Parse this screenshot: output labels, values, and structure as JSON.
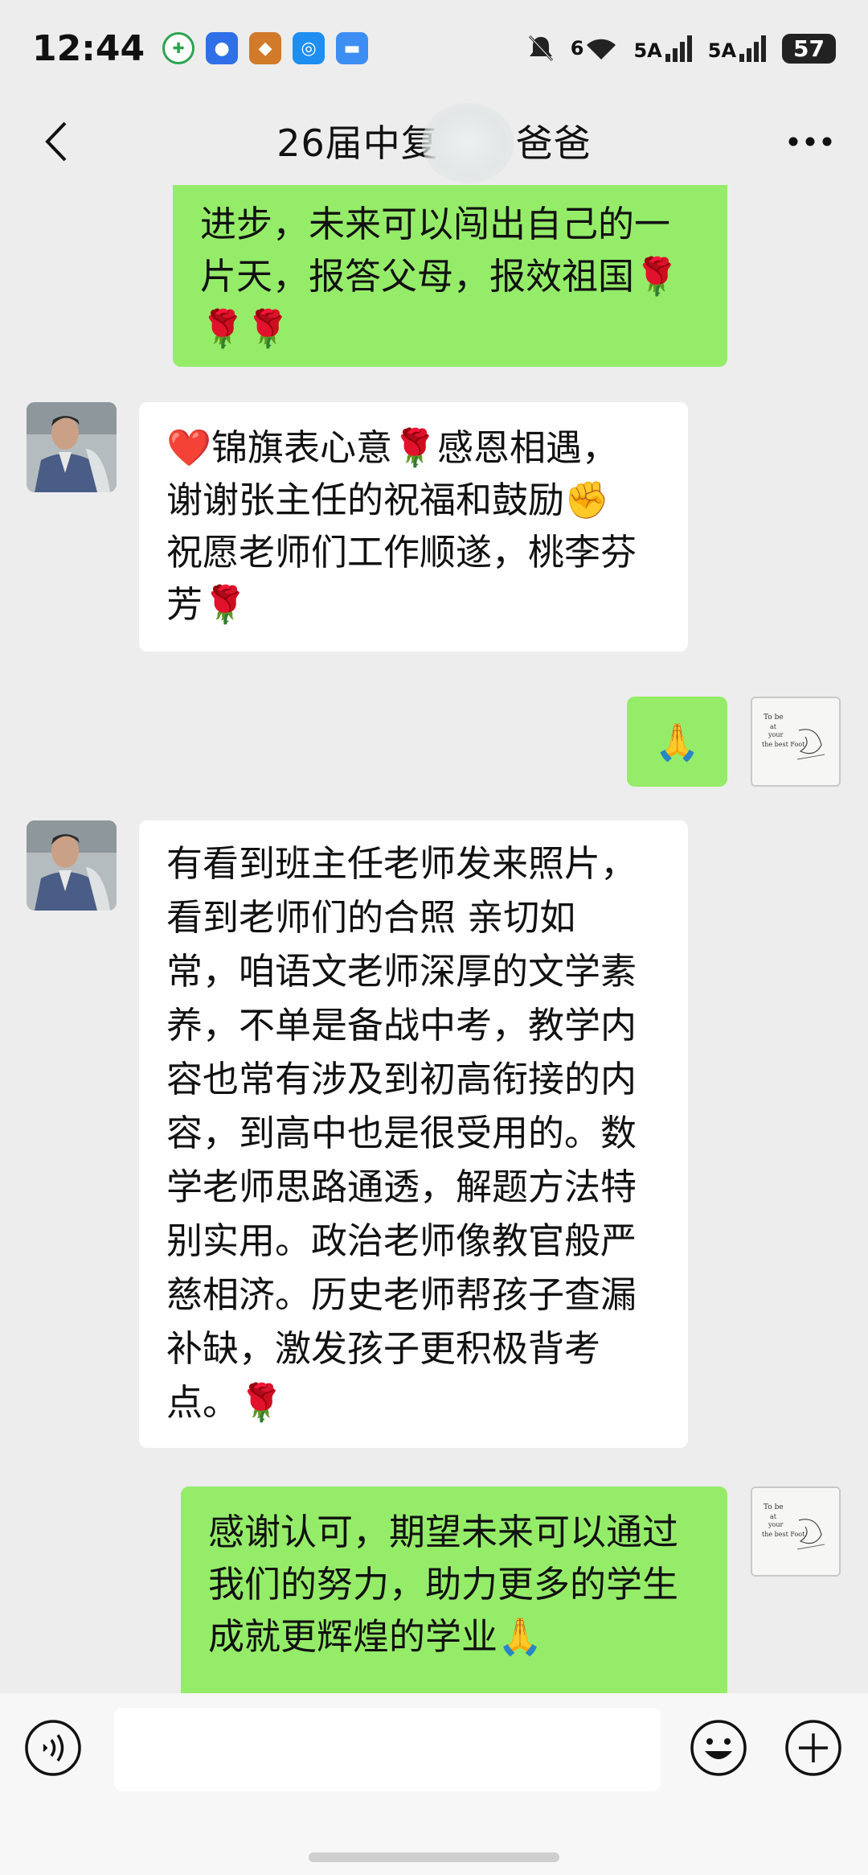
{
  "status_bar": {
    "time": "12:44",
    "signal_1": "6",
    "signal_2": "5A",
    "signal_3": "5A",
    "battery": "57"
  },
  "header": {
    "title": "26届中复",
    "title_suffix": "爸爸"
  },
  "messages": [
    {
      "side": "right",
      "lines": [
        "进步，未来可以闯出自己的一",
        "片天，报答父母，报效祖国🌹",
        "🌹🌹"
      ]
    },
    {
      "side": "left",
      "lines": [
        "❤️锦旗表心意🌹感恩相遇，",
        "谢谢张主任的祝福和鼓励✊",
        "祝愿老师们工作顺遂，桃李芬",
        "芳🌹"
      ]
    },
    {
      "side": "right",
      "lines": [
        "🙏"
      ]
    },
    {
      "side": "left",
      "lines": [
        "有看到班主任老师发来照片，",
        "看到老师们的合照 亲切如",
        "常，咱语文老师深厚的文学素",
        "养，不单是备战中考，教学内",
        "容也常有涉及到初高衔接的内",
        "容，到高中也是很受用的。数",
        "学老师思路通透，解题方法特",
        "别实用。政治老师像教官般严",
        "慈相济。历史老师帮孩子查漏",
        "补缺，激发孩子更积极背考",
        "点。🌹"
      ]
    },
    {
      "side": "right",
      "lines": [
        "感谢认可，期望未来可以通过",
        "我们的努力，助力更多的学生",
        "成就更辉煌的学业🙏"
      ]
    }
  ],
  "my_avatar_text": [
    "To be",
    "at",
    "your",
    "the best Foot"
  ],
  "colors": {
    "my_bubble": "#95ec69",
    "their_bubble": "#ffffff",
    "background": "#ededed"
  },
  "icons": {
    "back": "chevron-left-icon",
    "more": "more-dots-icon",
    "voice": "voice-icon",
    "emoji": "emoji-icon",
    "plus": "plus-icon"
  }
}
